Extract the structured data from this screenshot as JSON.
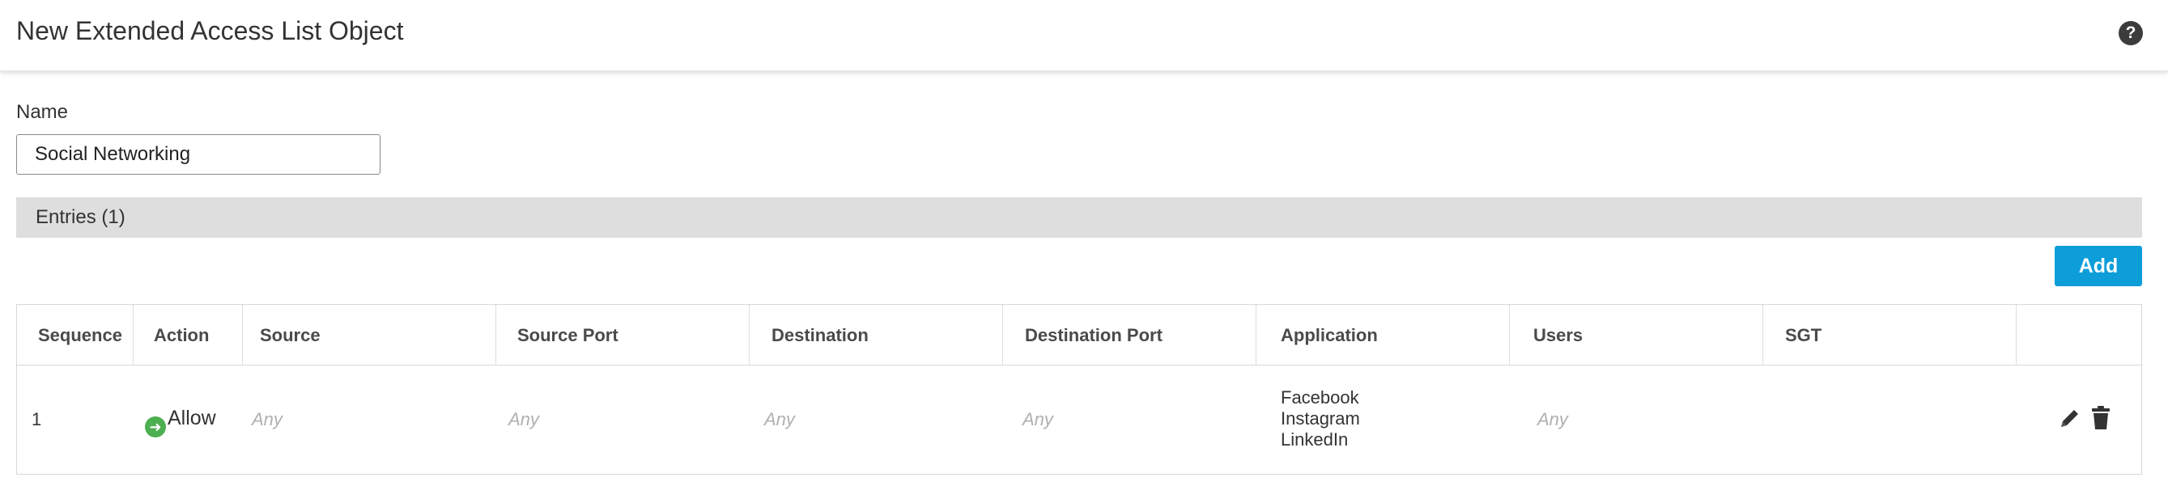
{
  "header": {
    "title": "New Extended Access List Object",
    "help_icon": "help-icon"
  },
  "form": {
    "name_label": "Name",
    "name_value": "Social Networking"
  },
  "entries": {
    "label": "Entries (1)",
    "add_label": "Add"
  },
  "table": {
    "columns": [
      "Sequence",
      "Action",
      "Source",
      "Source Port",
      "Destination",
      "Destination Port",
      "Application",
      "Users",
      "SGT"
    ],
    "rows": [
      {
        "sequence": "1",
        "action": "Allow",
        "action_icon": "allow-arrow-icon",
        "source": "Any",
        "source_port": "Any",
        "destination": "Any",
        "destination_port": "Any",
        "applications": [
          "Facebook",
          "Instagram",
          "LinkedIn"
        ],
        "users": "Any",
        "sgt": ""
      }
    ]
  },
  "colors": {
    "accent": "#0d9ed9",
    "allow": "#4caf50",
    "bar": "#dedede"
  }
}
